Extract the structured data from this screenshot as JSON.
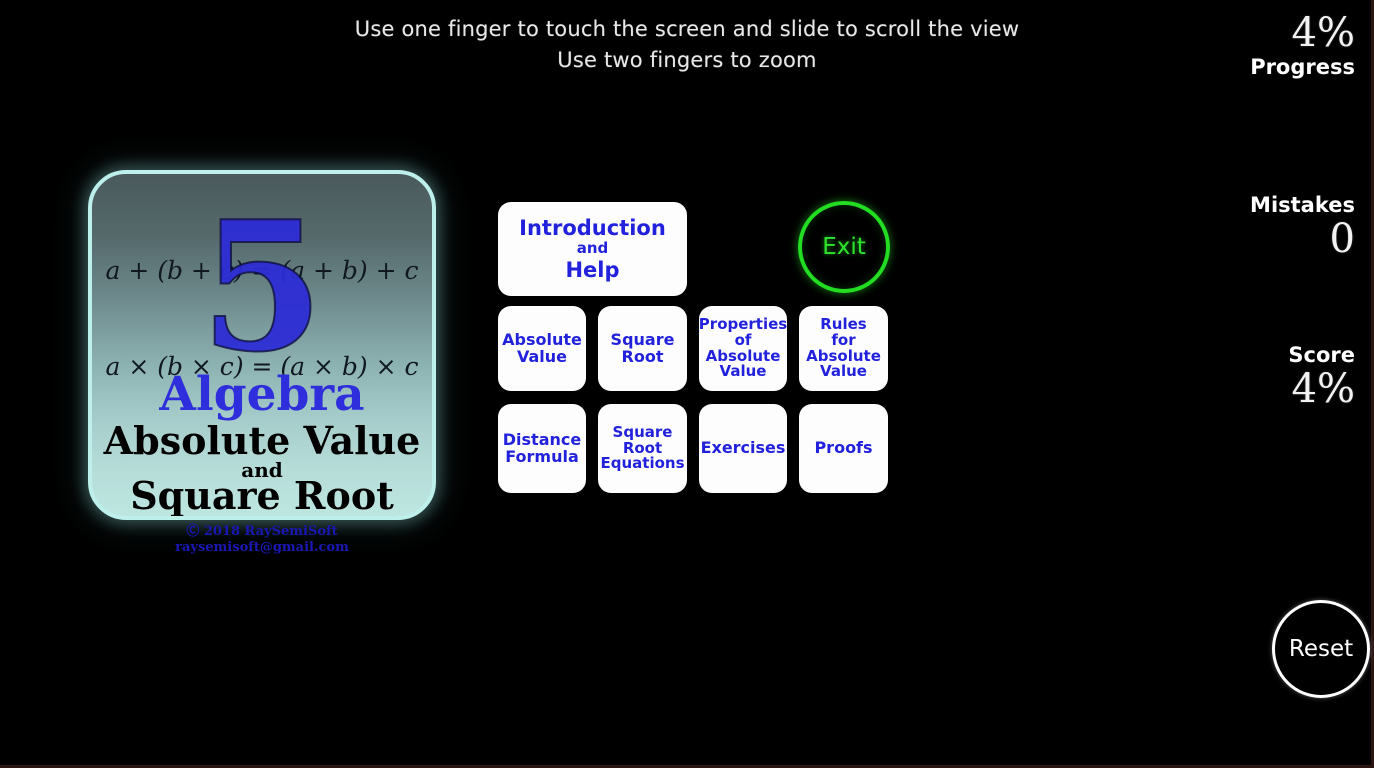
{
  "instructions": {
    "line1": "Use one finger to touch the screen and slide to scroll the view",
    "line2": "Use two fingers to zoom"
  },
  "stats": {
    "progress": {
      "value": "4%",
      "label": "Progress"
    },
    "mistakes": {
      "label": "Mistakes",
      "value": "0"
    },
    "score": {
      "label": "Score",
      "value": "4%"
    }
  },
  "title_card": {
    "formula_1": "a + (b + c) = (a + b) + c",
    "formula_2": "a × (b × c) = (a × b) × c",
    "chapter_number": "5",
    "subject": "Algebra",
    "topic_line1": "Absolute Value",
    "topic_conjunction": "and",
    "topic_line2": "Square Root",
    "copyright_line1": "Ⓒ 2018 RaySemiSoft",
    "copyright_line2": "raysemisoft@gmail.com"
  },
  "menu": {
    "introduction": {
      "line1": "Introduction",
      "line2": "and",
      "line3": "Help"
    },
    "exit": "Exit",
    "reset": "Reset",
    "buttons_row2": [
      {
        "name": "absolute-value",
        "lines": [
          "Absolute",
          "Value"
        ]
      },
      {
        "name": "square-root",
        "lines": [
          "Square",
          "Root"
        ]
      },
      {
        "name": "properties-of-absolute-value",
        "lines": [
          "Properties",
          "of",
          "Absolute",
          "Value"
        ]
      },
      {
        "name": "rules-for-absolute-value",
        "lines": [
          "Rules",
          "for",
          "Absolute",
          "Value"
        ]
      }
    ],
    "buttons_row3": [
      {
        "name": "distance-formula",
        "lines": [
          "Distance",
          "Formula"
        ]
      },
      {
        "name": "square-root-equations",
        "lines": [
          "Square",
          "Root",
          "Equations"
        ]
      },
      {
        "name": "exercises",
        "lines": [
          "Exercises"
        ]
      },
      {
        "name": "proofs",
        "lines": [
          "Proofs"
        ]
      }
    ]
  },
  "colors": {
    "background": "#000000",
    "button_text": "#2222dd",
    "button_face": "#fdfdfd",
    "exit_green": "#22dd22",
    "reset_white": "#ffffff",
    "card_border": "#bdf0ea",
    "card_title_blue": "#2e2edc"
  }
}
